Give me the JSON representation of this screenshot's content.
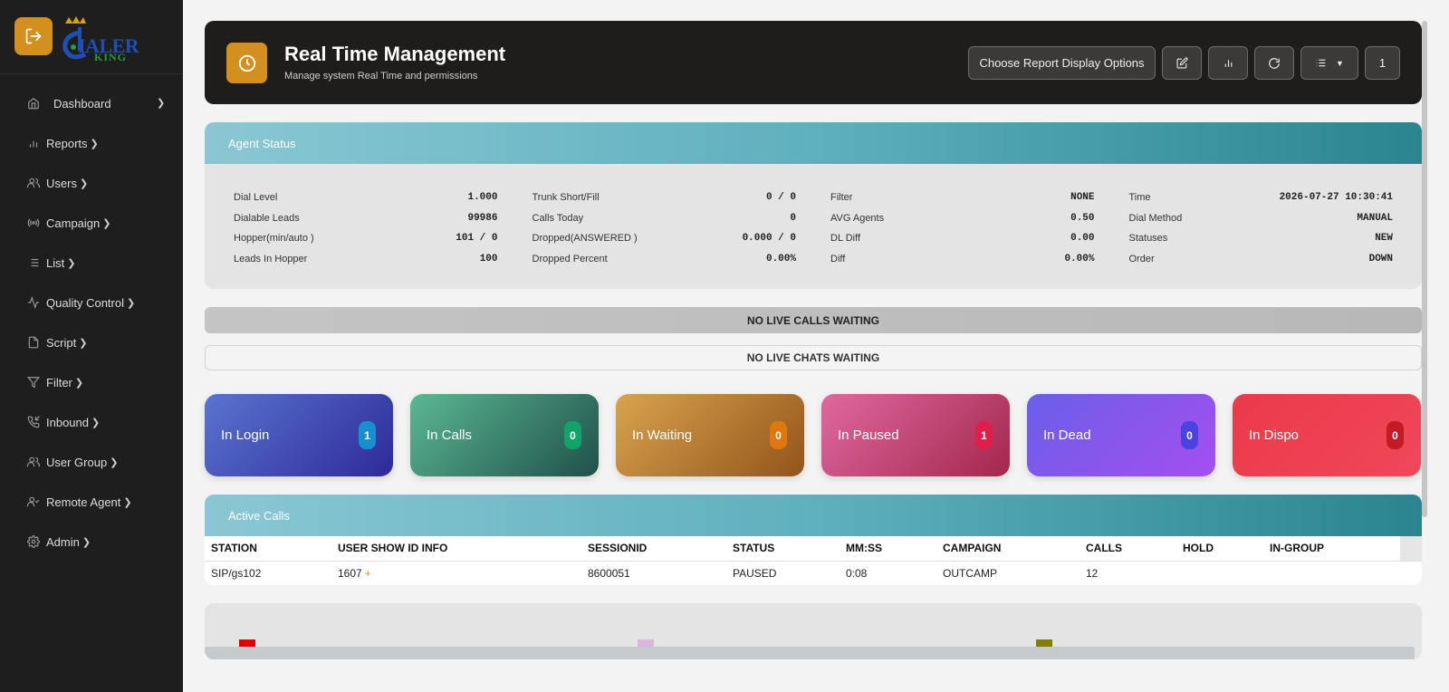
{
  "brand": {
    "logo_text": "IALER",
    "logo_sub": "KING"
  },
  "sidebar": {
    "items": [
      {
        "label": "Dashboard",
        "icon": "home-icon"
      },
      {
        "label": "Reports",
        "icon": "bar-chart-icon"
      },
      {
        "label": "Users",
        "icon": "users-icon"
      },
      {
        "label": "Campaign",
        "icon": "broadcast-icon"
      },
      {
        "label": "List",
        "icon": "list-icon"
      },
      {
        "label": "Quality Control",
        "icon": "activity-icon"
      },
      {
        "label": "Script",
        "icon": "file-icon"
      },
      {
        "label": "Filter",
        "icon": "filter-icon"
      },
      {
        "label": "Inbound",
        "icon": "phone-incoming-icon"
      },
      {
        "label": "User Group",
        "icon": "users-icon"
      },
      {
        "label": "Remote Agent",
        "icon": "user-check-icon"
      },
      {
        "label": "Admin",
        "icon": "gear-icon"
      }
    ]
  },
  "header": {
    "title": "Real Time Management",
    "subtitle": "Manage system Real Time and permissions",
    "report_options_label": "Choose Report Display Options",
    "counter": "1"
  },
  "agent_status": {
    "title": "Agent Status",
    "columns": [
      [
        {
          "label": "Dial Level",
          "value": "1.000"
        },
        {
          "label": "Dialable Leads",
          "value": "99986"
        },
        {
          "label": "Hopper(min/auto )",
          "value": "101 / 0"
        },
        {
          "label": "Leads In Hopper",
          "value": "100"
        }
      ],
      [
        {
          "label": "Trunk Short/Fill",
          "value": "0 / 0"
        },
        {
          "label": "Calls Today",
          "value": "0"
        },
        {
          "label": "Dropped(ANSWERED )",
          "value": "0.000 / 0"
        },
        {
          "label": "Dropped Percent",
          "value": "0.00%"
        }
      ],
      [
        {
          "label": "Filter",
          "value": "NONE"
        },
        {
          "label": "AVG Agents",
          "value": "0.50"
        },
        {
          "label": "DL Diff",
          "value": "0.00"
        },
        {
          "label": "Diff",
          "value": "0.00%"
        }
      ],
      [
        {
          "label": "Time",
          "value": "2026-07-27 10:30:41"
        },
        {
          "label": "Dial Method",
          "value": "MANUAL"
        },
        {
          "label": "Statuses",
          "value": "NEW"
        },
        {
          "label": "Order",
          "value": "DOWN"
        }
      ]
    ]
  },
  "banners": {
    "calls": "NO LIVE CALLS WAITING",
    "chats": "NO LIVE CHATS WAITING"
  },
  "tiles": [
    {
      "label": "In Login",
      "count": "1",
      "gradient": [
        "#5a74cf",
        "#2e2a9a"
      ],
      "badge_color": "#1a8fd0"
    },
    {
      "label": "In Calls",
      "count": "0",
      "gradient": [
        "#5bb894",
        "#20504a"
      ],
      "badge_color": "#12a36a"
    },
    {
      "label": "In Waiting",
      "count": "0",
      "gradient": [
        "#d9a34e",
        "#93541b"
      ],
      "badge_color": "#e0780f"
    },
    {
      "label": "In Paused",
      "count": "1",
      "gradient": [
        "#e0689e",
        "#a3284e"
      ],
      "badge_color": "#e01e4a"
    },
    {
      "label": "In Dead",
      "count": "0",
      "gradient": [
        "#6a5ee8",
        "#a54ff0"
      ],
      "badge_color": "#4a43e0"
    },
    {
      "label": "In Dispo",
      "count": "0",
      "gradient": [
        "#ea3a4a",
        "#f0475a"
      ],
      "badge_color": "#c41a26"
    }
  ],
  "active_calls": {
    "title": "Active Calls",
    "headers": [
      "STATION",
      "USER SHOW ID INFO",
      "SESSIONID",
      "STATUS",
      "MM:SS",
      "CAMPAIGN",
      "CALLS",
      "HOLD",
      "IN-GROUP"
    ],
    "rows": [
      [
        "SIP/gs102",
        "1607",
        "8600051",
        "PAUSED",
        "0:08",
        "OUTCAMP",
        "12",
        "",
        ""
      ]
    ],
    "plus": "+"
  },
  "colors": {
    "accent": "#d4901e",
    "sidebar": "#1e1e1e",
    "header_bg": "#1e1d1b"
  }
}
